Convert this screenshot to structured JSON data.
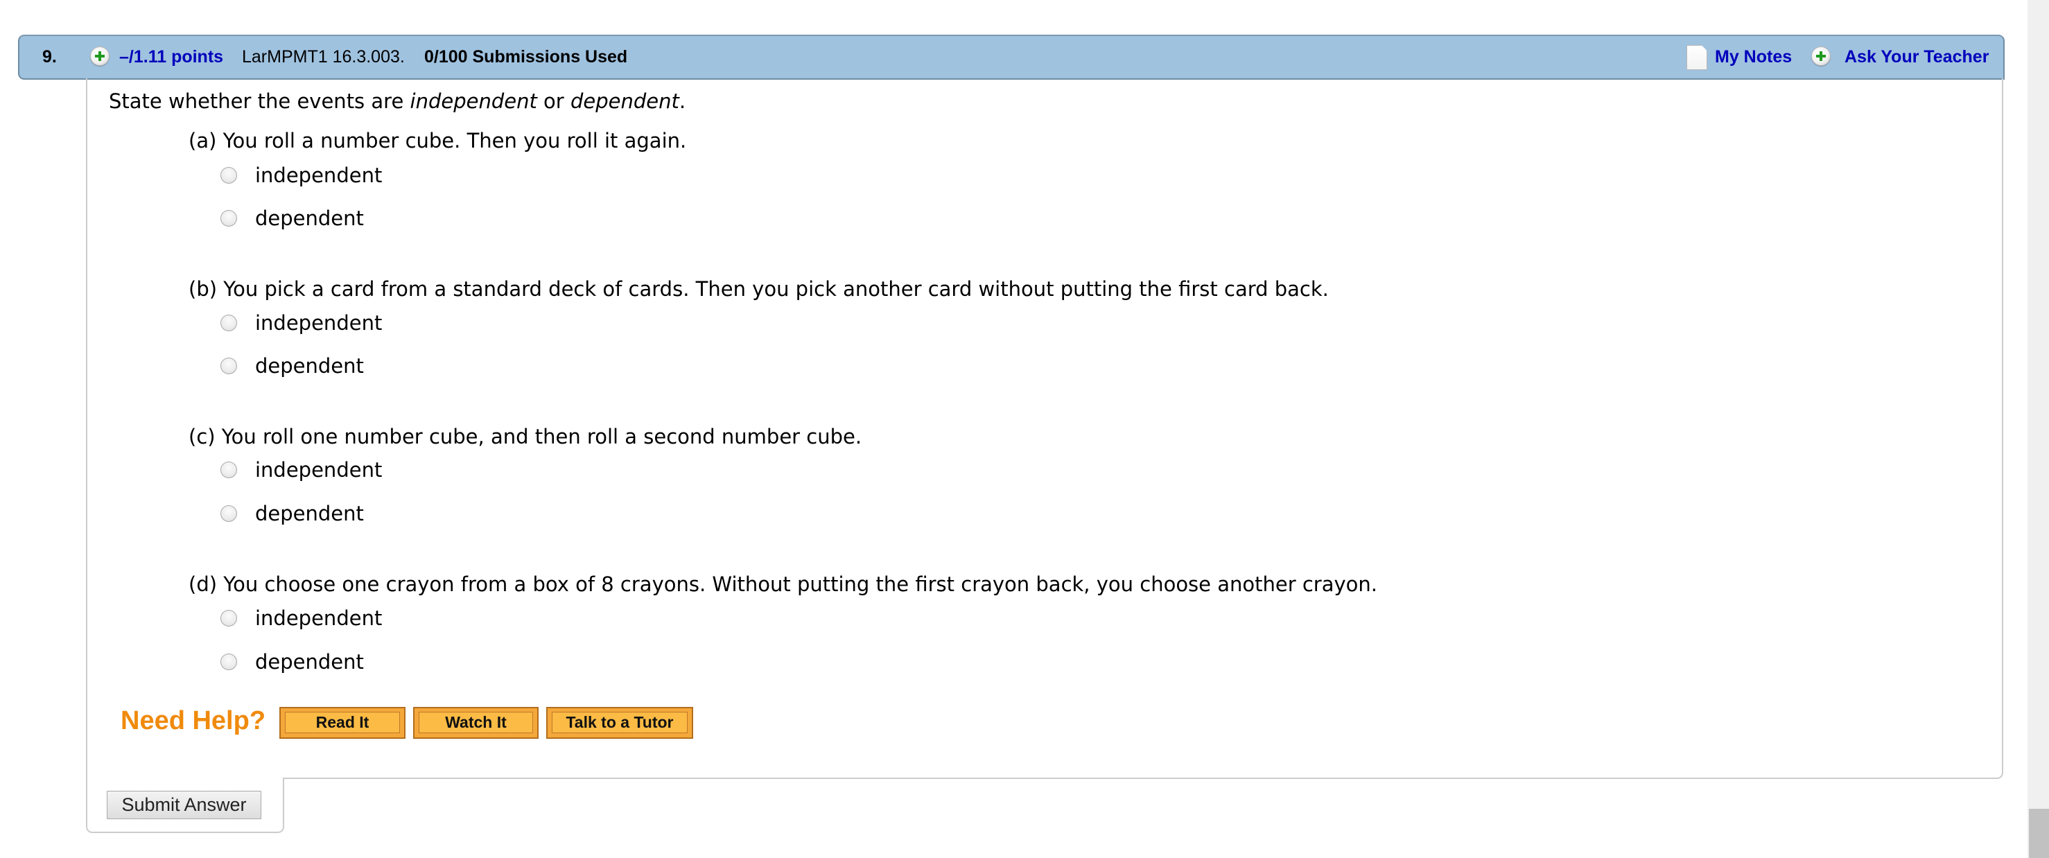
{
  "header": {
    "question_number": "9.",
    "points": "–/1.11 points",
    "problem_code": "LarMPMT1 16.3.003.",
    "submissions": "0/100 Submissions Used",
    "my_notes": "My Notes",
    "ask_teacher": "Ask Your Teacher",
    "icons": {
      "points_toggle": "plus-circle-icon",
      "notes": "notes-document-icon",
      "ask_teacher": "plus-circle-icon"
    },
    "colors": {
      "bar_bg": "#9fc2df",
      "link": "#0000bb"
    }
  },
  "question": {
    "prompt_before": "State whether the events are ",
    "prompt_term1": "independent",
    "prompt_middle": " or ",
    "prompt_term2": "dependent",
    "prompt_after": ".",
    "parts": [
      {
        "label": "(a) You roll a number cube. Then you roll it again.",
        "options": [
          "independent",
          "dependent"
        ],
        "selected": null
      },
      {
        "label": "(b) You pick a card from a standard deck of cards. Then you pick another card without putting the first card back.",
        "options": [
          "independent",
          "dependent"
        ],
        "selected": null
      },
      {
        "label": "(c) You roll one number cube, and then roll a second number cube.",
        "options": [
          "independent",
          "dependent"
        ],
        "selected": null
      },
      {
        "label": "(d) You choose one crayon from a box of 8 crayons. Without putting the first crayon back, you choose another crayon.",
        "options": [
          "independent",
          "dependent"
        ],
        "selected": null
      }
    ]
  },
  "help": {
    "label": "Need Help?",
    "buttons": [
      "Read It",
      "Watch It",
      "Talk to a Tutor"
    ],
    "color": "#f08a0c"
  },
  "submit": {
    "label": "Submit Answer"
  }
}
